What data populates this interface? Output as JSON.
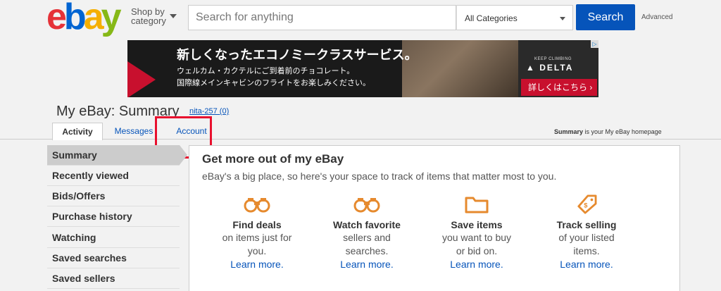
{
  "header": {
    "logo": {
      "e": "e",
      "b": "b",
      "a": "a",
      "y": "y"
    },
    "shop_by_line1": "Shop by",
    "shop_by_line2": "category",
    "search_placeholder": "Search for anything",
    "category_value": "All Categories",
    "search_button": "Search",
    "advanced": "Advanced"
  },
  "banner": {
    "headline": "新しくなったエコノミークラスサービス。",
    "line1": "ウェルカム・カクテルにご到着前のチョコレート。",
    "line2": "国際線メインキャビンのフライトをお楽しみください。",
    "keep_climbing": "KEEP CLIMBING",
    "brand": "DELTA",
    "details": "詳しくはこちら ›",
    "ad_badge": "▷"
  },
  "page": {
    "title": "My eBay: Summary",
    "user": "nita-257 (0)",
    "summary_note_bold": "Summary",
    "summary_note_rest": " is your My eBay homepage"
  },
  "tabs": [
    {
      "label": "Activity"
    },
    {
      "label": "Messages"
    },
    {
      "label": "Account"
    }
  ],
  "sidebar": {
    "items": [
      {
        "label": "Summary"
      },
      {
        "label": "Recently viewed"
      },
      {
        "label": "Bids/Offers"
      },
      {
        "label": "Purchase history"
      },
      {
        "label": "Watching"
      },
      {
        "label": "Saved searches"
      },
      {
        "label": "Saved sellers"
      }
    ]
  },
  "main": {
    "title": "Get more out of my eBay",
    "subtitle": "eBay's a big place, so here's your space to track of items that matter most to you.",
    "features": [
      {
        "icon": "binoculars-icon",
        "heading": "Find deals",
        "desc1": "on items just for",
        "desc2": "you.",
        "link": "Learn more."
      },
      {
        "icon": "binoculars-icon",
        "heading": "Watch favorite",
        "desc1": "sellers and",
        "desc2": "searches.",
        "link": "Learn more."
      },
      {
        "icon": "folder-icon",
        "heading": "Save items",
        "desc1": "you want to buy",
        "desc2": "or bid on.",
        "link": "Learn more."
      },
      {
        "icon": "price-tag-icon",
        "heading": "Track selling",
        "desc1": "of your listed",
        "desc2": "items.",
        "link": "Learn more."
      }
    ]
  },
  "colors": {
    "accent": "#0654ba",
    "icon_orange": "#e68a2e",
    "highlight": "#e8102e"
  }
}
